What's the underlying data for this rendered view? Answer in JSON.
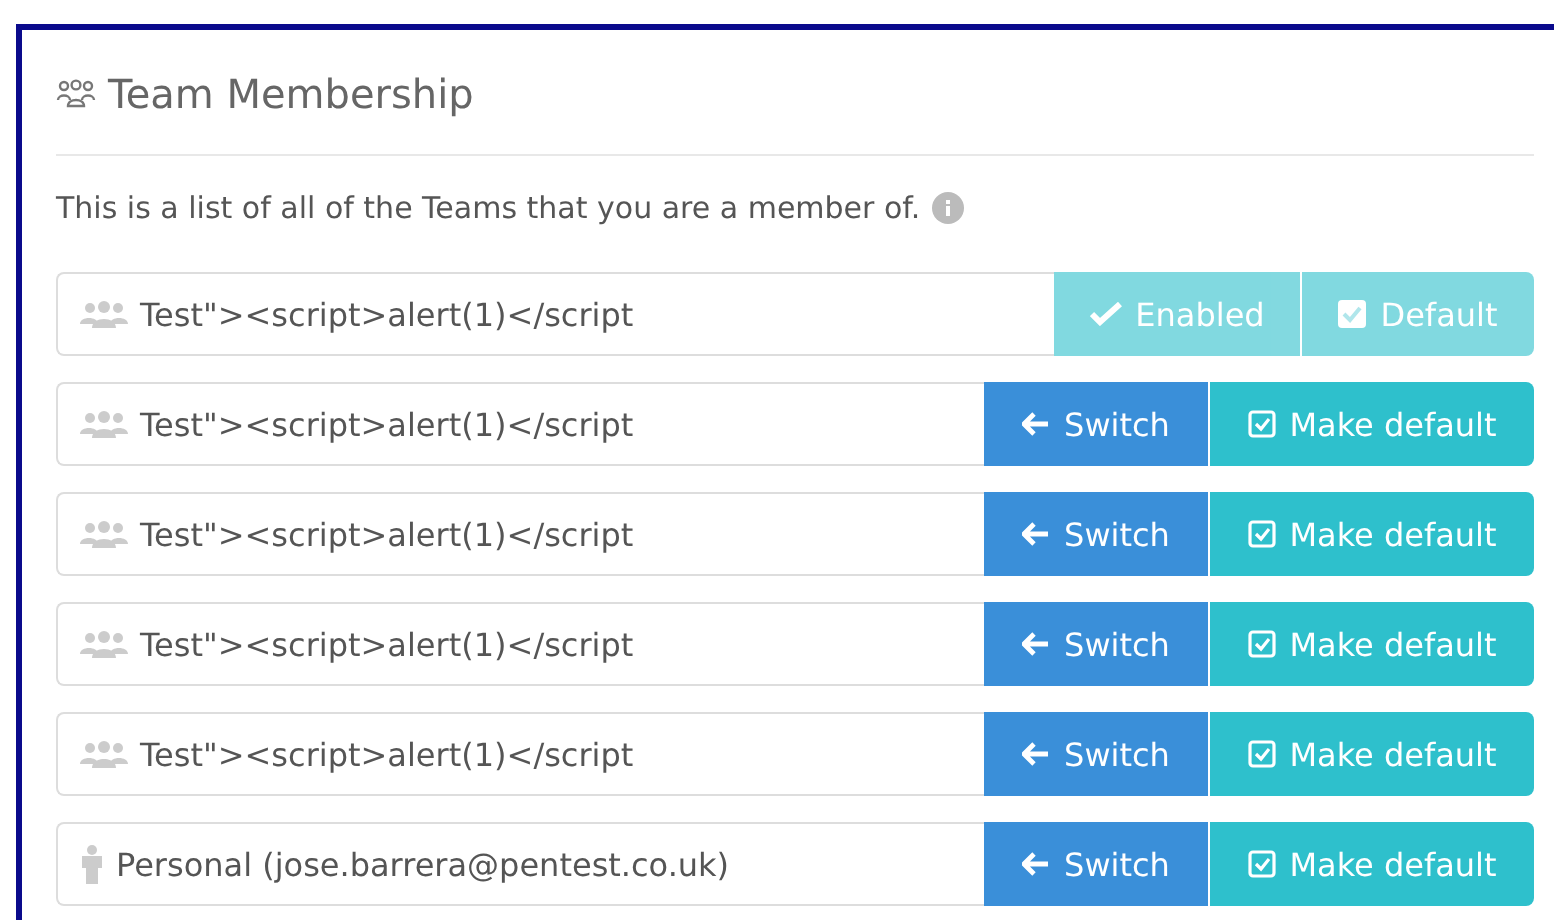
{
  "panel": {
    "title": "Team Membership",
    "description": "This is a list of all of the Teams that you are a member of."
  },
  "teams": [
    {
      "name": "Test\"><script>alert(1)</script",
      "kind": "team",
      "enabled": true,
      "buttons": [
        {
          "label": "Enabled",
          "kind": "check"
        },
        {
          "label": "Default",
          "kind": "box-checked"
        }
      ]
    },
    {
      "name": "Test\"><script>alert(1)</script",
      "kind": "team",
      "enabled": false,
      "buttons": [
        {
          "label": "Switch",
          "kind": "arrow"
        },
        {
          "label": "Make default",
          "kind": "box"
        }
      ]
    },
    {
      "name": "Test\"><script>alert(1)</script",
      "kind": "team",
      "enabled": false,
      "buttons": [
        {
          "label": "Switch",
          "kind": "arrow"
        },
        {
          "label": "Make default",
          "kind": "box"
        }
      ]
    },
    {
      "name": "Test\"><script>alert(1)</script",
      "kind": "team",
      "enabled": false,
      "buttons": [
        {
          "label": "Switch",
          "kind": "arrow"
        },
        {
          "label": "Make default",
          "kind": "box"
        }
      ]
    },
    {
      "name": "Test\"><script>alert(1)</script",
      "kind": "team",
      "enabled": false,
      "buttons": [
        {
          "label": "Switch",
          "kind": "arrow"
        },
        {
          "label": "Make default",
          "kind": "box"
        }
      ]
    },
    {
      "name": "Personal (jose.barrera@pentest.co.uk)",
      "kind": "personal",
      "enabled": false,
      "buttons": [
        {
          "label": "Switch",
          "kind": "arrow"
        },
        {
          "label": "Make default",
          "kind": "box"
        }
      ]
    }
  ]
}
